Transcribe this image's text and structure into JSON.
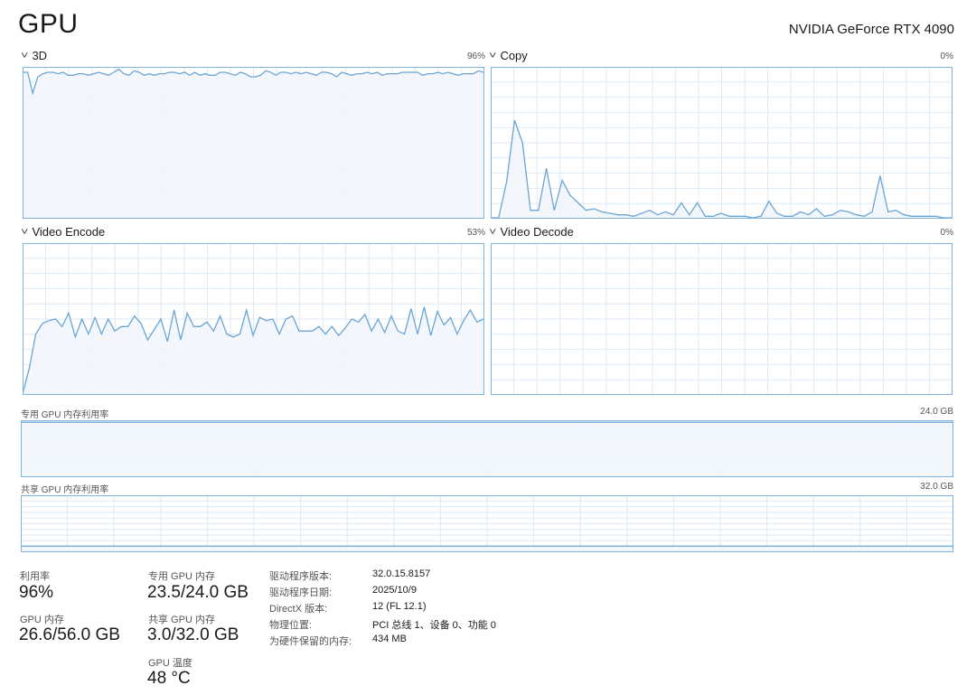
{
  "header": {
    "title": "GPU",
    "gpu_name": "NVIDIA GeForce RTX 4090"
  },
  "engines": [
    {
      "label": "3D",
      "percent": "96%",
      "series": [
        97,
        97,
        83,
        94,
        96,
        97,
        97,
        96,
        97,
        95,
        95,
        96,
        96,
        95,
        96,
        97,
        96,
        95,
        97,
        99,
        96,
        95,
        98,
        97,
        95,
        96,
        95,
        96,
        96,
        97,
        97,
        96,
        97,
        95,
        97,
        95,
        96,
        95,
        95,
        97,
        97,
        96,
        95,
        97,
        96,
        94,
        94,
        95,
        98,
        97,
        95,
        97,
        97,
        96,
        97,
        96,
        97,
        96,
        95,
        97,
        97,
        96,
        94,
        97,
        96,
        95,
        96,
        96,
        97,
        96,
        97,
        95,
        96,
        96,
        96,
        97,
        97,
        97,
        97,
        95,
        96,
        96,
        97,
        96,
        97,
        96,
        95,
        96,
        96,
        96,
        98,
        97
      ]
    },
    {
      "label": "Copy",
      "percent": "0%",
      "series": [
        0,
        0,
        24,
        65,
        50,
        5,
        5,
        33,
        5,
        25,
        15,
        10,
        5,
        6,
        4,
        3,
        2,
        2,
        1,
        3,
        5,
        2,
        4,
        2,
        10,
        2,
        10,
        1,
        1,
        3,
        1,
        1,
        1,
        0,
        1,
        11,
        3,
        1,
        1,
        4,
        2,
        6,
        1,
        2,
        5,
        4,
        2,
        1,
        4,
        28,
        4,
        5,
        2,
        1,
        1,
        1,
        1,
        0,
        0
      ]
    },
    {
      "label": "Video Encode",
      "percent": "53%",
      "series": [
        0,
        17,
        40,
        47,
        49,
        50,
        45,
        54,
        38,
        50,
        40,
        51,
        40,
        50,
        42,
        45,
        45,
        52,
        47,
        36,
        43,
        50,
        35,
        56,
        36,
        54,
        45,
        45,
        48,
        42,
        52,
        40,
        38,
        40,
        56,
        39,
        51,
        49,
        50,
        40,
        50,
        52,
        42,
        42,
        42,
        45,
        40,
        45,
        39,
        44,
        50,
        48,
        53,
        42,
        50,
        41,
        52,
        42,
        40,
        57,
        40,
        58,
        39,
        55,
        46,
        51,
        40,
        49,
        56,
        48,
        50
      ]
    },
    {
      "label": "Video Decode",
      "percent": "0%",
      "series": []
    }
  ],
  "memory_graphs": [
    {
      "label": "专用 GPU 内存利用率",
      "max": "24.0 GB",
      "usage_fraction": 0.979
    },
    {
      "label": "共享 GPU 内存利用率",
      "max": "32.0 GB",
      "usage_fraction": 0.094
    }
  ],
  "stats": {
    "utilization": {
      "label": "利用率",
      "value": "96%"
    },
    "gpu_memory": {
      "label": "GPU 内存",
      "value": "26.6/56.0 GB"
    },
    "dedicated_memory": {
      "label": "专用 GPU 内存",
      "value": "23.5/24.0 GB"
    },
    "shared_memory": {
      "label": "共享 GPU 内存",
      "value": "3.0/32.0 GB"
    },
    "temperature": {
      "label": "GPU 温度",
      "value": "48 °C"
    }
  },
  "details": [
    {
      "key": "驱动程序版本:",
      "value": "32.0.15.8157"
    },
    {
      "key": "驱动程序日期:",
      "value": "2025/10/9"
    },
    {
      "key": "DirectX 版本:",
      "value": "12 (FL 12.1)"
    },
    {
      "key": "物理位置:",
      "value": "PCI 总线 1、设备 0、功能 0"
    },
    {
      "key": "为硬件保留的内存:",
      "value": "434 MB"
    }
  ],
  "colors": {
    "line": "#6aa5d6",
    "fill": "#f1f6fc",
    "border": "#7fb3df",
    "grid": "#dce9f5"
  }
}
